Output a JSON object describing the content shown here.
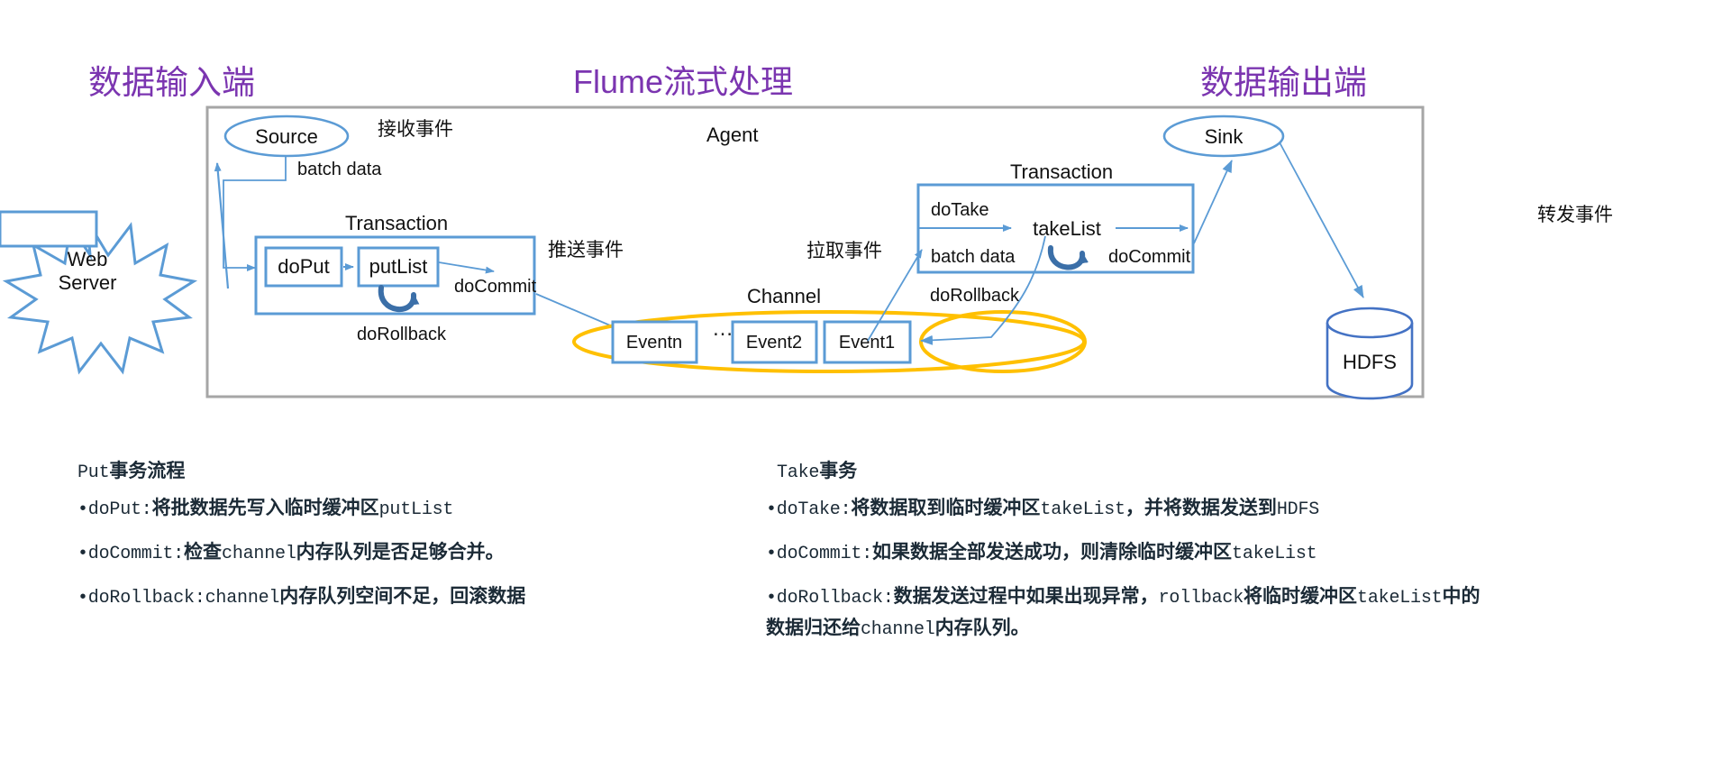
{
  "titles": {
    "left": "数据输入端",
    "center": "Flume流式处理",
    "right": "数据输出端"
  },
  "colors": {
    "title_purple": "#7B35B0",
    "flow_blue": "#5B9BD5",
    "node_blue": "#4472C4",
    "channel_orange": "#FFC000",
    "agent_border": "#A6A6A6",
    "loop_arrow": "#3B6FA8",
    "text_dark": "#1b2a36"
  },
  "diagram": {
    "agent_label": "Agent",
    "web_server": "Web\nServer",
    "web_server_line1": "Web",
    "web_server_line2": "Server",
    "source": "Source",
    "sink": "Sink",
    "hdfs": "HDFS",
    "channel": "Channel",
    "receive_event": "接收事件",
    "push_event": "推送事件",
    "pull_event": "拉取事件",
    "forward_event": "转发事件",
    "batch_data_left": "batch data",
    "batch_data_right": "batch data",
    "put_transaction": {
      "title": "Transaction",
      "do_put": "doPut",
      "put_list": "putList",
      "do_commit": "doCommit",
      "do_rollback": "doRollback"
    },
    "take_transaction": {
      "title": "Transaction",
      "do_take": "doTake",
      "take_list": "takeList",
      "do_commit": "doCommit",
      "do_rollback": "doRollback"
    },
    "events": [
      {
        "label": "Eventn"
      },
      {
        "label": "Event2"
      },
      {
        "label": "Event1"
      }
    ],
    "events_ellipsis": "…"
  },
  "notes": {
    "put": {
      "heading_latin": "Put",
      "heading_cjk": "事务流程",
      "items": [
        [
          {
            "t": "mono",
            "v": "•doPut:"
          },
          {
            "t": "cjk",
            "v": "将批数据先写入临时缓冲区"
          },
          {
            "t": "mono",
            "v": "putList"
          }
        ],
        [
          {
            "t": "mono",
            "v": "•doCommit:"
          },
          {
            "t": "cjk",
            "v": "检查"
          },
          {
            "t": "mono",
            "v": "channel"
          },
          {
            "t": "cjk",
            "v": "内存队列是否足够合并。"
          }
        ],
        [
          {
            "t": "mono",
            "v": "•doRollback:channel"
          },
          {
            "t": "cjk",
            "v": "内存队列空间不足，回滚数据"
          }
        ]
      ]
    },
    "take": {
      "heading_latin": "Take",
      "heading_cjk": "事务",
      "items": [
        [
          {
            "t": "mono",
            "v": "•doTake:"
          },
          {
            "t": "cjk",
            "v": "将数据取到临时缓冲区"
          },
          {
            "t": "mono",
            "v": "takeList"
          },
          {
            "t": "cjk",
            "v": "，并将数据发送到"
          },
          {
            "t": "mono",
            "v": "HDFS"
          }
        ],
        [
          {
            "t": "mono",
            "v": "•doCommit:"
          },
          {
            "t": "cjk",
            "v": "如果数据全部发送成功，则清除临时缓冲区"
          },
          {
            "t": "mono",
            "v": "takeList"
          }
        ],
        [
          {
            "t": "mono",
            "v": "•doRollback:"
          },
          {
            "t": "cjk",
            "v": "数据发送过程中如果出现异常，"
          },
          {
            "t": "mono",
            "v": "rollback"
          },
          {
            "t": "cjk",
            "v": "将临时缓冲区"
          },
          {
            "t": "mono",
            "v": "takeList"
          },
          {
            "t": "cjk",
            "v": "中的数据归还给"
          },
          {
            "t": "mono",
            "v": "channel"
          },
          {
            "t": "cjk",
            "v": "内存队列。"
          }
        ]
      ]
    }
  }
}
